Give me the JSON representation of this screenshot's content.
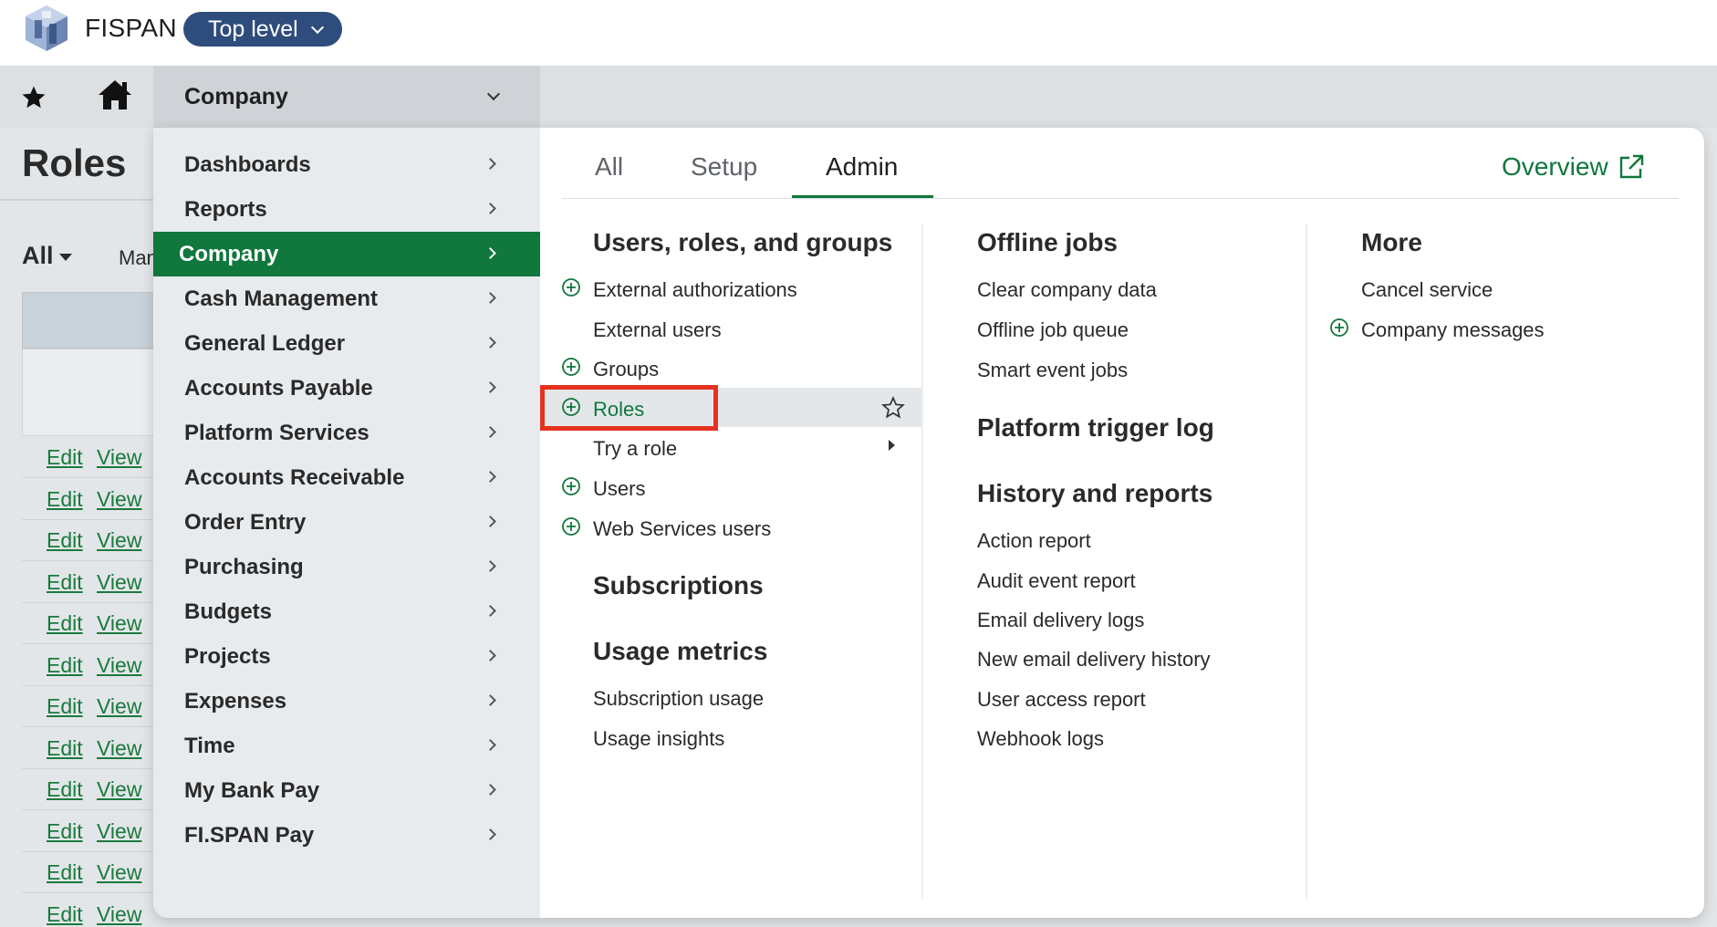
{
  "header": {
    "brand": "FISPAN",
    "level_selector": "Top level",
    "logo_icon": "cube-logo-icon"
  },
  "nav": {
    "star_icon": "star-icon",
    "home_icon": "home-icon",
    "current_module": "Company"
  },
  "page": {
    "title": "Roles",
    "filter": "All",
    "truncated_label": "Man",
    "rows": [
      {
        "edit": "Edit",
        "view": "View"
      },
      {
        "edit": "Edit",
        "view": "View"
      },
      {
        "edit": "Edit",
        "view": "View"
      },
      {
        "edit": "Edit",
        "view": "View"
      },
      {
        "edit": "Edit",
        "view": "View"
      },
      {
        "edit": "Edit",
        "view": "View"
      },
      {
        "edit": "Edit",
        "view": "View"
      },
      {
        "edit": "Edit",
        "view": "View"
      },
      {
        "edit": "Edit",
        "view": "View"
      },
      {
        "edit": "Edit",
        "view": "View"
      },
      {
        "edit": "Edit",
        "view": "View"
      },
      {
        "edit": "Edit",
        "view": "View"
      }
    ]
  },
  "menu": {
    "modules": [
      "Dashboards",
      "Reports",
      "Company",
      "Cash Management",
      "General Ledger",
      "Accounts Payable",
      "Platform Services",
      "Accounts Receivable",
      "Order Entry",
      "Purchasing",
      "Budgets",
      "Projects",
      "Expenses",
      "Time",
      "My Bank Pay",
      "FI.SPAN Pay"
    ],
    "active_module": "Company",
    "tabs": [
      "All",
      "Setup",
      "Admin"
    ],
    "active_tab": "Admin",
    "overview": "Overview",
    "col1": {
      "heading": "Users, roles, and groups",
      "items": [
        {
          "label": "External authorizations",
          "plus": true
        },
        {
          "label": "External users",
          "plus": false
        },
        {
          "label": "Groups",
          "plus": true
        },
        {
          "label": "Roles",
          "plus": true,
          "highlighted": true
        },
        {
          "label": "Try a role",
          "plus": false,
          "submenu": true
        },
        {
          "label": "Users",
          "plus": true
        },
        {
          "label": "Web Services users",
          "plus": true
        }
      ],
      "heading2": "Subscriptions",
      "heading3": "Usage metrics",
      "items3": [
        "Subscription usage",
        "Usage insights"
      ]
    },
    "col2": {
      "heading": "Offline jobs",
      "items": [
        "Clear company data",
        "Offline job queue",
        "Smart event jobs"
      ],
      "heading2": "Platform trigger log",
      "heading3": "History and reports",
      "items3": [
        "Action report",
        "Audit event report",
        "Email delivery logs",
        "New email delivery history",
        "User access report",
        "Webhook logs"
      ]
    },
    "col3": {
      "heading": "More",
      "items": [
        {
          "label": "Cancel service",
          "plus": false
        },
        {
          "label": "Company messages",
          "plus": true
        }
      ]
    }
  },
  "colors": {
    "accent_green": "#10773d",
    "pill_blue": "#2e4d7c",
    "highlight_red": "#e5321f"
  }
}
